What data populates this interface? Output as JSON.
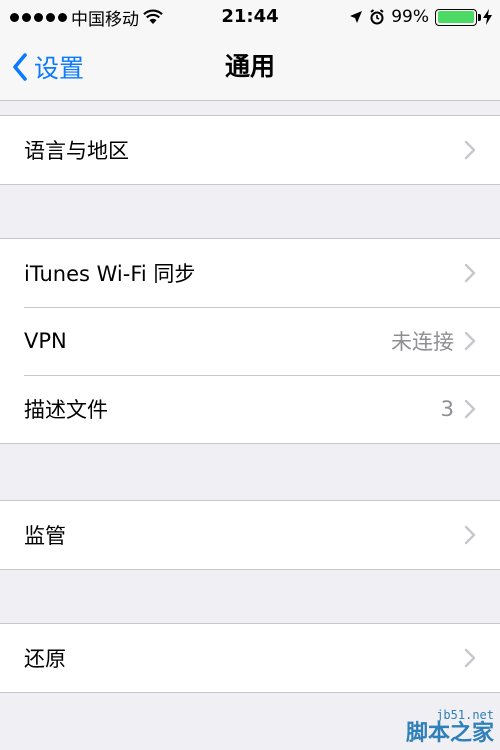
{
  "status_bar": {
    "carrier": "中国移动",
    "time": "21:44",
    "battery_percent": "99%",
    "battery_level": 0.99,
    "battery_color": "#4cd964"
  },
  "nav": {
    "back_label": "设置",
    "title": "通用",
    "accent_color": "#0a7aff"
  },
  "groups": {
    "language": {
      "label": "语言与地区"
    },
    "network": {
      "itunes_wifi_sync": {
        "label": "iTunes Wi-Fi 同步"
      },
      "vpn": {
        "label": "VPN",
        "value": "未连接"
      },
      "profiles": {
        "label": "描述文件",
        "value": "3"
      }
    },
    "supervision": {
      "label": "监管"
    },
    "reset": {
      "label": "还原"
    }
  },
  "watermark": {
    "site": "jb51.net",
    "name": "脚本之家"
  },
  "icons": [
    "signal-dots-icon",
    "wifi-icon",
    "location-arrow-icon",
    "alarm-icon",
    "battery-icon",
    "charging-bolt-icon",
    "chevron-left-icon",
    "chevron-right-icon"
  ]
}
